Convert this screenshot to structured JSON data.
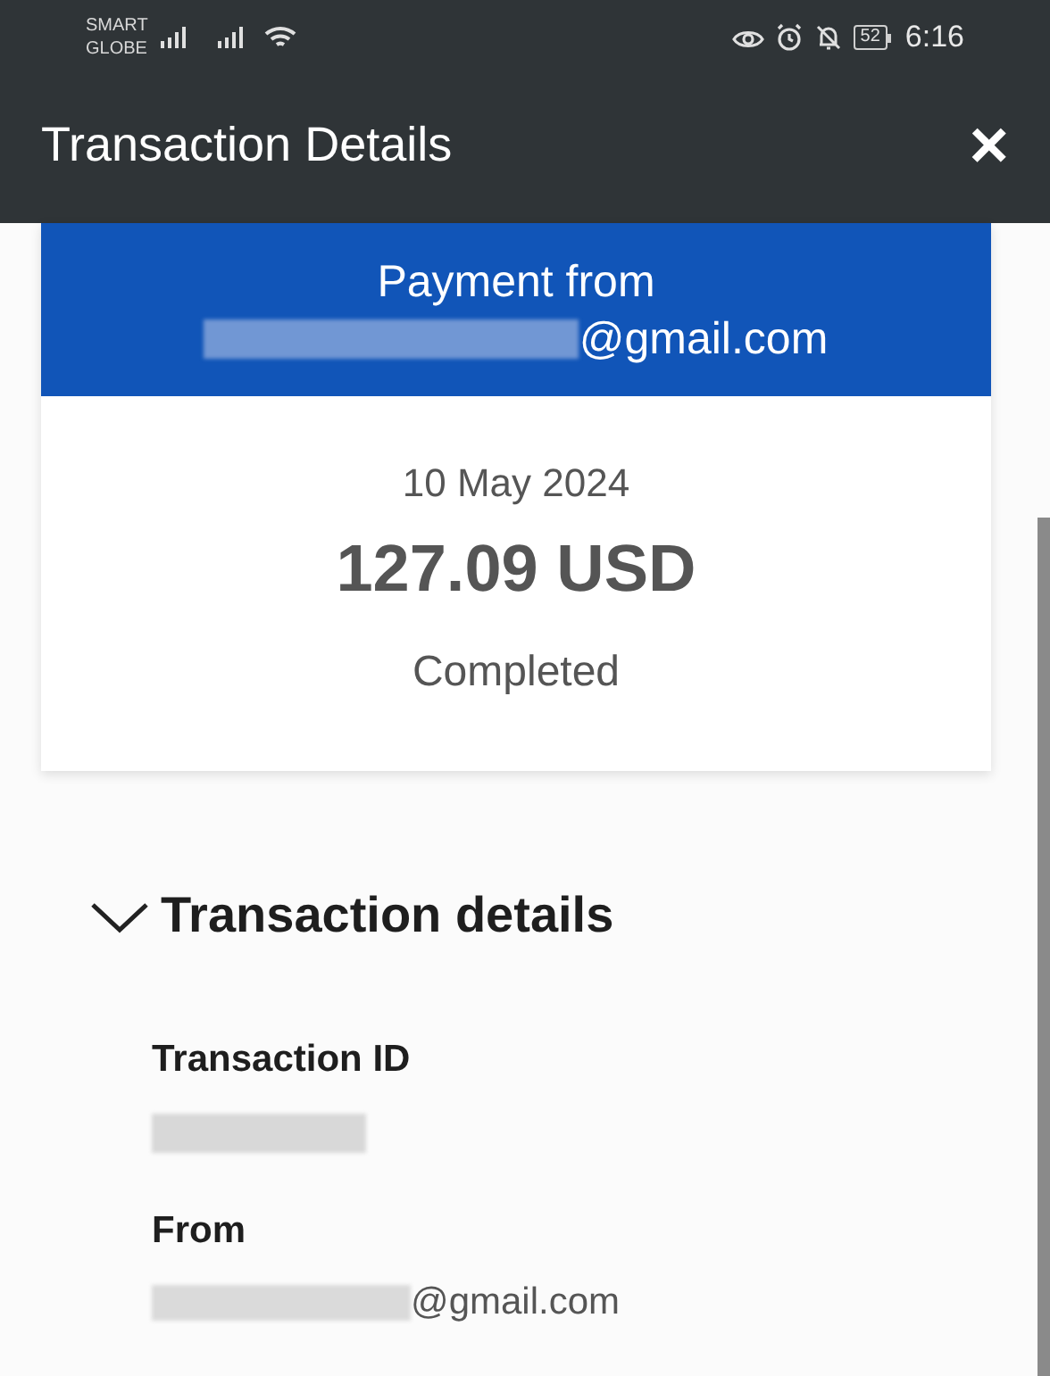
{
  "status_bar": {
    "carrier": [
      "SMART",
      "GLOBE"
    ],
    "battery": "52",
    "time": "6:16"
  },
  "header": {
    "title": "Transaction Details",
    "close": "×"
  },
  "banner": {
    "line_1": "Payment from",
    "email_domain": "@gmail.com"
  },
  "summary": {
    "date": "10 May 2024",
    "amount": "127.09 USD",
    "status": "Completed"
  },
  "details": {
    "title": "Transaction details",
    "expanded": true,
    "fields": [
      {
        "label": "Transaction ID",
        "kind": "redacted"
      },
      {
        "label": "From",
        "kind": "email",
        "value": "@gmail.com"
      }
    ]
  }
}
